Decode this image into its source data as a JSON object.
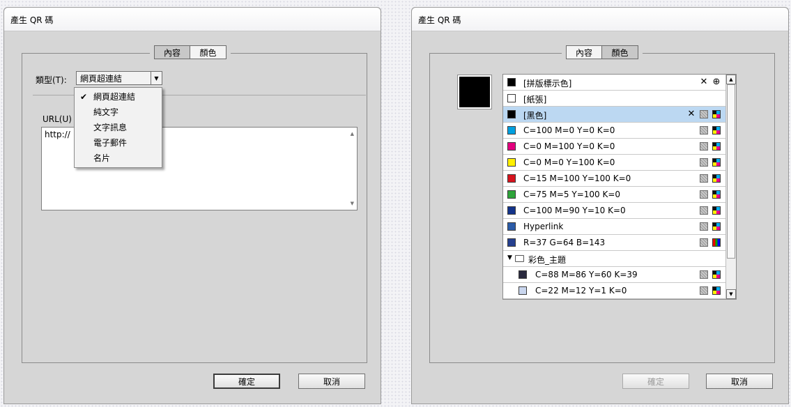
{
  "left_dialog": {
    "title": "產生 QR 碼",
    "tabs": [
      {
        "label": "內容",
        "active": true
      },
      {
        "label": "顏色",
        "active": false
      }
    ],
    "type_label": "類型(T):",
    "type_select_value": "網頁超連結",
    "url_label": "URL(U)",
    "url_value": "http://",
    "dropdown_items": [
      {
        "label": "網頁超連結",
        "checked": true,
        "check_mark": "✔"
      },
      {
        "label": "純文字"
      },
      {
        "label": "文字訊息"
      },
      {
        "label": "電子郵件"
      },
      {
        "label": "名片"
      }
    ],
    "ok_label": "確定",
    "cancel_label": "取消"
  },
  "right_dialog": {
    "title": "產生 QR 碼",
    "tabs": [
      {
        "label": "內容",
        "active": false
      },
      {
        "label": "顏色",
        "active": true
      }
    ],
    "selected_color_preview": "#000000",
    "swatches": [
      {
        "name": "[拼版標示色]",
        "color": "#000000",
        "icons": [
          "pen-off",
          "registration"
        ]
      },
      {
        "name": "[紙張]",
        "color": "#ffffff",
        "icons": []
      },
      {
        "name": "[黑色]",
        "color": "#000000",
        "icons": [
          "pen-off",
          "spot-gray",
          "cmyk"
        ],
        "selected": true
      },
      {
        "name": "C=100 M=0 Y=0 K=0",
        "color": "#00a0e0",
        "icons": [
          "spot-gray",
          "cmyk"
        ]
      },
      {
        "name": "C=0 M=100 Y=0 K=0",
        "color": "#e4007f",
        "icons": [
          "spot-gray",
          "cmyk"
        ]
      },
      {
        "name": "C=0 M=0 Y=100 K=0",
        "color": "#fff000",
        "icons": [
          "spot-gray",
          "cmyk"
        ]
      },
      {
        "name": "C=15 M=100 Y=100 K=0",
        "color": "#d7141e",
        "icons": [
          "spot-gray",
          "cmyk"
        ]
      },
      {
        "name": "C=75 M=5 Y=100 K=0",
        "color": "#2ea43a",
        "icons": [
          "spot-gray",
          "cmyk"
        ]
      },
      {
        "name": "C=100 M=90 Y=10 K=0",
        "color": "#13338a",
        "icons": [
          "spot-gray",
          "cmyk"
        ]
      },
      {
        "name": "Hyperlink",
        "color": "#2b5ca8",
        "icons": [
          "spot-gray",
          "cmyk"
        ]
      },
      {
        "name": "R=37 G=64 B=143",
        "color": "#25408f",
        "icons": [
          "spot-gray",
          "rgb"
        ]
      },
      {
        "name": "彩色_主題",
        "folder": true
      },
      {
        "name": "C=88 M=86 Y=60 K=39",
        "color": "#2a2a3f",
        "icons": [
          "spot-gray",
          "cmyk"
        ],
        "child": true
      },
      {
        "name": "C=22 M=12 Y=1 K=0",
        "color": "#c9d6ee",
        "icons": [
          "spot-gray",
          "cmyk"
        ],
        "child": true
      }
    ],
    "ok_label": "確定",
    "ok_disabled": true,
    "cancel_label": "取消"
  }
}
